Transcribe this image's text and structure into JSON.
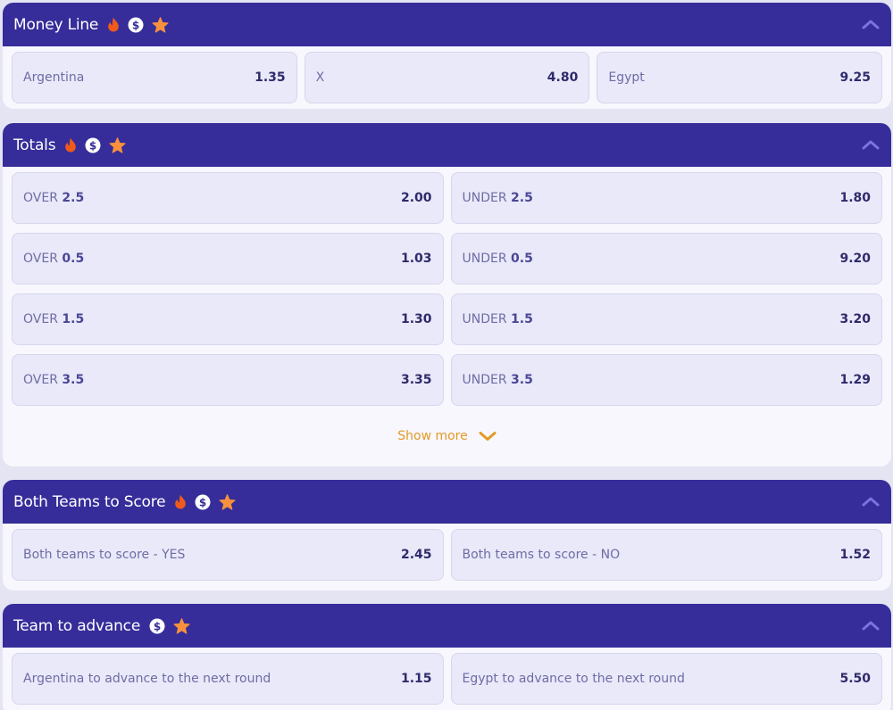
{
  "colors": {
    "header_bg": "#362d9a",
    "card_bg": "#e9e9f9",
    "fire_icon": "#f05a1a",
    "star_icon": "#f7913d",
    "show_more": "#e39a25"
  },
  "money_line": {
    "title": "Money Line",
    "icons": [
      "fire-icon",
      "dollar-icon",
      "star-icon"
    ],
    "outcomes": [
      {
        "label": "Argentina",
        "odds": "1.35"
      },
      {
        "label": "X",
        "odds": "4.80"
      },
      {
        "label": "Egypt",
        "odds": "9.25"
      }
    ]
  },
  "totals": {
    "title": "Totals",
    "icons": [
      "fire-icon",
      "dollar-icon",
      "star-icon"
    ],
    "rows": [
      [
        {
          "prefix": "OVER",
          "line": "2.5",
          "odds": "2.00"
        },
        {
          "prefix": "UNDER",
          "line": "2.5",
          "odds": "1.80"
        }
      ],
      [
        {
          "prefix": "OVER",
          "line": "0.5",
          "odds": "1.03"
        },
        {
          "prefix": "UNDER",
          "line": "0.5",
          "odds": "9.20"
        }
      ],
      [
        {
          "prefix": "OVER",
          "line": "1.5",
          "odds": "1.30"
        },
        {
          "prefix": "UNDER",
          "line": "1.5",
          "odds": "3.20"
        }
      ],
      [
        {
          "prefix": "OVER",
          "line": "3.5",
          "odds": "3.35"
        },
        {
          "prefix": "UNDER",
          "line": "3.5",
          "odds": "1.29"
        }
      ]
    ],
    "show_more_label": "Show more"
  },
  "btts": {
    "title": "Both Teams to Score",
    "icons": [
      "fire-icon",
      "dollar-icon",
      "star-icon"
    ],
    "outcomes": [
      {
        "label": "Both teams to score - YES",
        "odds": "2.45"
      },
      {
        "label": "Both teams to score - NO",
        "odds": "1.52"
      }
    ]
  },
  "advance": {
    "title": "Team to advance",
    "icons": [
      "dollar-icon",
      "star-icon"
    ],
    "outcomes": [
      {
        "label": "Argentina to advance to the next round",
        "odds": "1.15"
      },
      {
        "label": "Egypt to advance to the next round",
        "odds": "5.50"
      }
    ]
  }
}
